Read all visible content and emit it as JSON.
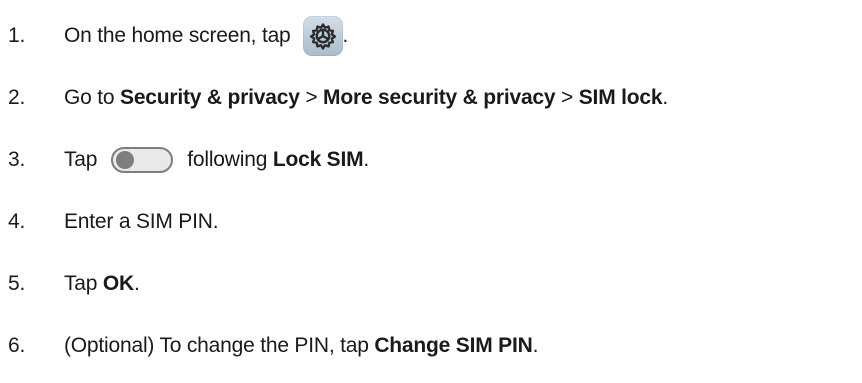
{
  "steps": [
    {
      "number": "1.",
      "text": "On the home screen, tap",
      "suffix": ".",
      "icon": "settings-gear-icon"
    },
    {
      "number": "2.",
      "prefix": "Go to",
      "item1": "Security & privacy",
      "sep1": ">",
      "item2": "More security & privacy",
      "sep2": ">",
      "item3": "SIM lock",
      "suffix": "."
    },
    {
      "number": "3.",
      "prefix": "Tap",
      "icon": "toggle-switch-off-icon",
      "middle": "following",
      "bold": "Lock SIM",
      "suffix": "."
    },
    {
      "number": "4.",
      "text": "Enter a SIM PIN."
    },
    {
      "number": "5.",
      "prefix": "Tap",
      "bold": "OK",
      "suffix": "."
    },
    {
      "number": "6.",
      "prefix": "(Optional) To change the PIN, tap",
      "bold": "Change SIM PIN",
      "suffix": "."
    }
  ]
}
